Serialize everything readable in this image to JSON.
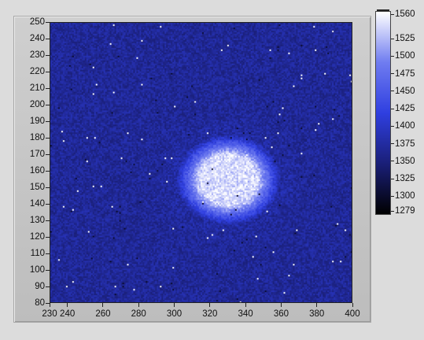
{
  "chart_data": {
    "type": "heatmap",
    "title": "",
    "xlabel": "",
    "ylabel": "",
    "xlim": [
      230,
      400
    ],
    "ylim": [
      80,
      250
    ],
    "x_ticks": [
      230,
      240,
      260,
      280,
      300,
      320,
      340,
      360,
      380,
      400
    ],
    "y_ticks": [
      80,
      90,
      100,
      110,
      120,
      130,
      140,
      150,
      160,
      170,
      180,
      190,
      200,
      210,
      220,
      230,
      240,
      250
    ],
    "colorbar": {
      "min": 1279,
      "max": 1560,
      "ticks": [
        1279,
        1300,
        1325,
        1350,
        1375,
        1400,
        1425,
        1450,
        1475,
        1500,
        1525,
        1560
      ],
      "colors": [
        "#000000",
        "#1a1f78",
        "#2f3fe0",
        "#6f7cf0",
        "#ffffff"
      ]
    },
    "background_level": 1370,
    "spot": {
      "center": [
        330,
        155
      ],
      "radius_x": 30,
      "radius_y": 28,
      "peak_level": 1555
    },
    "colors": {
      "panel": "#c8c8c8",
      "background": "#dcdcdc"
    }
  }
}
